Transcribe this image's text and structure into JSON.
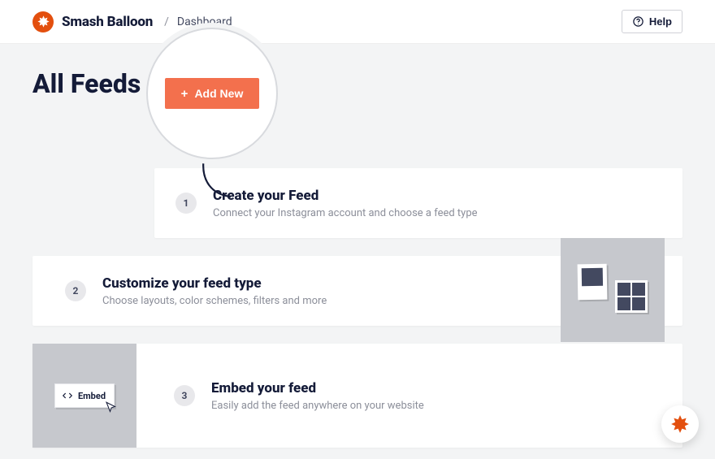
{
  "header": {
    "brand": "Smash Balloon",
    "crumb": "Dashboard",
    "help_label": "Help"
  },
  "page": {
    "title": "All Feeds",
    "add_new_label": "Add New"
  },
  "steps": [
    {
      "num": "1",
      "title": "Create your Feed",
      "desc": "Connect your Instagram account and choose a feed type"
    },
    {
      "num": "2",
      "title": "Customize your feed type",
      "desc": "Choose layouts, color schemes, filters and more"
    },
    {
      "num": "3",
      "title": "Embed your feed",
      "desc": "Easily add the feed anywhere on your website"
    }
  ],
  "card3_embed_label": "Embed"
}
